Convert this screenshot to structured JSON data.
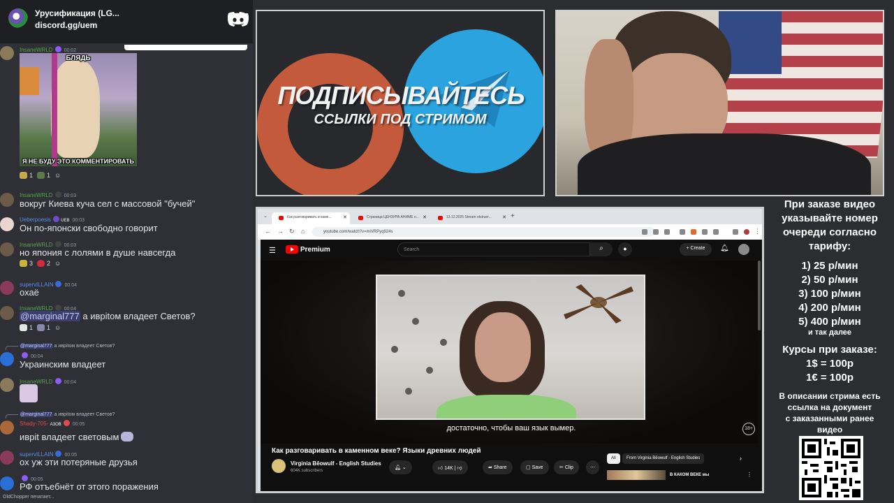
{
  "chat": {
    "server_name": "Урусификация (LG...",
    "server_invite": "discord.gg/uem",
    "gif_top": "БЛЯДЬ",
    "gif_bottom": "Я НЕ БУДУ ЭТО КОММЕНТИРОВАТЬ",
    "messages": [
      {
        "user": "InsaneWRLD",
        "time": "00:02",
        "text": ""
      },
      {
        "user": "InsaneWRLD",
        "time": "00:03",
        "text": "вокруг Киева куча сел с массовой \"бучей\""
      },
      {
        "user": "Ueberpoesis",
        "tag": "UEB",
        "time": "00:03",
        "text": "Он по-японски свободно говорит"
      },
      {
        "user": "InsaneWRLD",
        "time": "00:03",
        "text": "но япония с лолями в душе навсегда"
      },
      {
        "user": "supervILLAIN",
        "time": "00:04",
        "text": "охаё"
      },
      {
        "user": "InsaneWRLD",
        "time": "00:04",
        "mention": "@marginal777",
        "text": " а иврitом владеет Светов?"
      },
      {
        "user": "",
        "time": "00:04",
        "reply_mention": "@marginal777",
        "reply_text": "а иврitом владеет Светов?",
        "text": "Украинским владеет"
      },
      {
        "user": "InsaneWRLD",
        "time": "00:04",
        "text": ""
      },
      {
        "user": "Shady-705-",
        "tag": "АЗОВ",
        "time": "00:05",
        "reply_mention": "@marginal777",
        "reply_text": "а иврitом владеет Светов?",
        "text": "иврit владеет световым"
      },
      {
        "user": "supervILLAIN",
        "time": "00:05",
        "text": "ох уж эти потеряные друзья"
      },
      {
        "user": "",
        "time": "00:05",
        "text": "РФ отъебнёт от этого поражения"
      }
    ],
    "reactions_1": [
      "1",
      "1"
    ],
    "reactions_3": [
      "3",
      "2"
    ],
    "reactions_5": [
      "1",
      "1"
    ],
    "typing": "OldChopper печатает..."
  },
  "banner": {
    "title": "ПОДПИСЫВАЙТЕСЬ",
    "subtitle": "ССЫЛКИ ПОД СТРИМОМ"
  },
  "browser": {
    "tabs": [
      {
        "label": "Как разговаривать в каме..."
      },
      {
        "label": "Страница ЦЕНЗУРА АНИМЕ о..."
      },
      {
        "label": "13.12.2025 Stream otstruer..."
      }
    ],
    "new_tab": "+",
    "url": "youtube.com/watch?v=miVRPyq924s"
  },
  "youtube": {
    "brand": "Premium",
    "search_placeholder": "Search",
    "create_label": "Create",
    "subtitle": "достаточно, чтобы ваш язык вымер.",
    "age_badge": "18+",
    "video_title": "Как разговаривать в каменном веке? Языки древних людей",
    "channel_name": "Virginia Bēowulf - English Studies",
    "channel_subs": "604K subscribers",
    "likes": "14K",
    "share": "Share",
    "save": "Save",
    "clip": "Clip",
    "chip_all": "All",
    "chip_from": "From Virginia Bēowulf - English Studies",
    "rec_title": "В КАКОМ ВЕКЕ мы"
  },
  "price_panel": {
    "header": [
      "При заказе видео",
      "указывайте номер",
      "очереди согласно",
      "тарифу:"
    ],
    "tiers": [
      "1) 25 р/мин",
      "2) 50 р/мин",
      "3) 100 р/мин",
      "4) 200 р/мин",
      "5) 400 р/мин"
    ],
    "etc": "и так далее",
    "courses_title": "Курсы при заказе:",
    "rates": [
      "1$ = 100р",
      "1€ = 100р"
    ],
    "footer": [
      "В описании стрима есть",
      "ссылка на документ",
      "с заказанными ранее",
      "видео"
    ]
  },
  "colors": {
    "chat_bg": "#2e3035",
    "youtube_red": "#ff0000",
    "telegram_blue": "#2aa3df",
    "patreon_orange": "#c45a3c",
    "username_green": "#57a64a",
    "username_blue": "#5b8def",
    "username_red": "#e5484d"
  }
}
